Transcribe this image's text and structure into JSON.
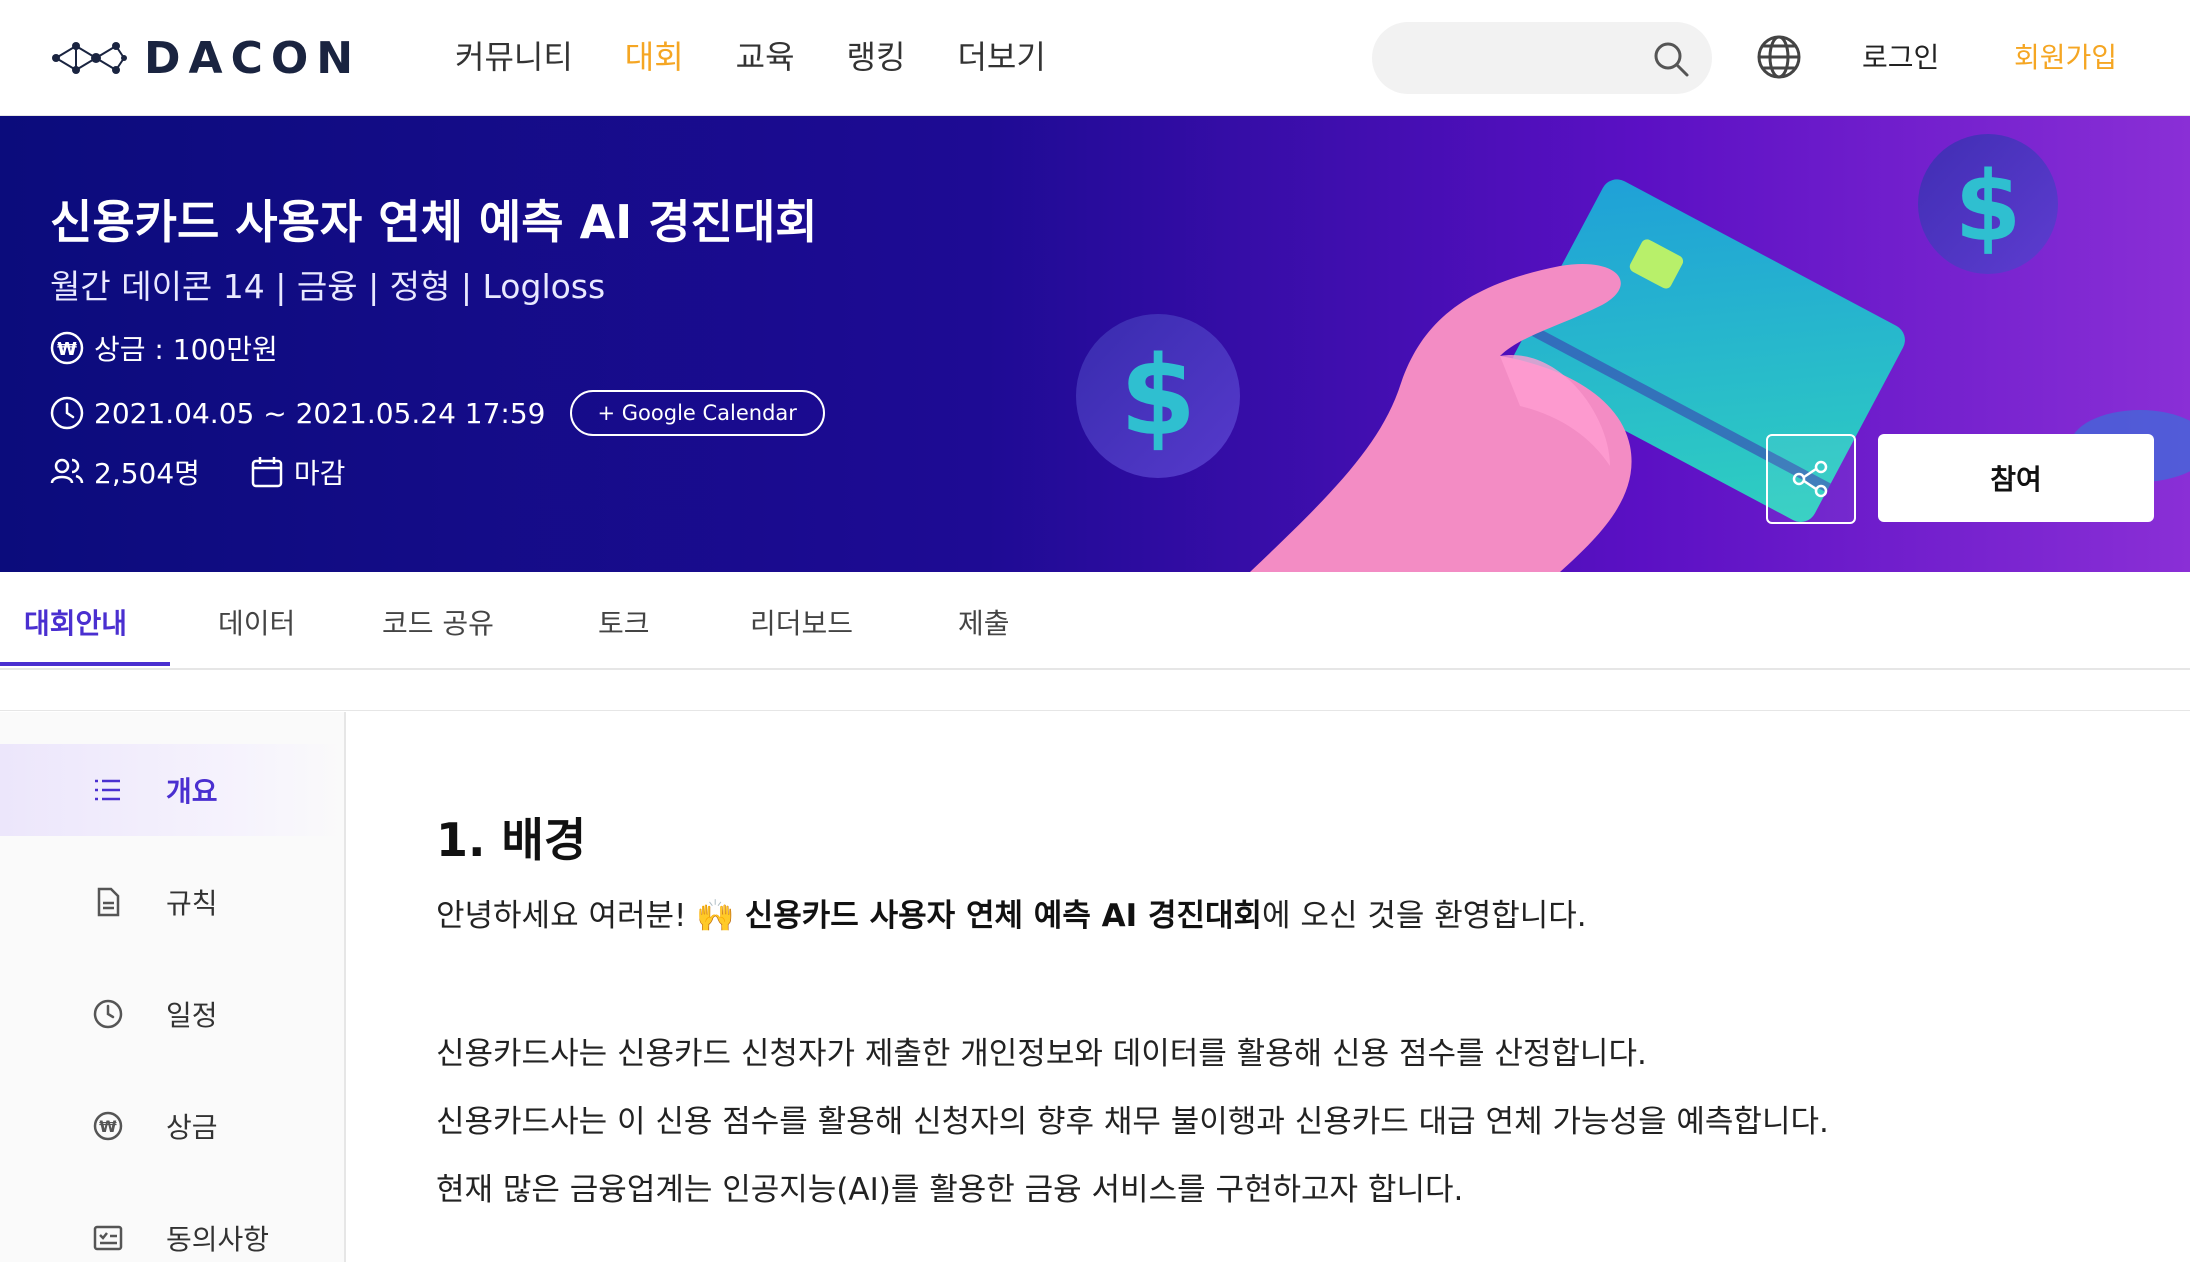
{
  "header": {
    "logo_text": "DACON",
    "nav": [
      "커뮤니티",
      "대회",
      "교육",
      "랭킹",
      "더보기"
    ],
    "active_nav": "대회",
    "search_placeholder": "",
    "login": "로그인",
    "signup": "회원가입"
  },
  "banner": {
    "title": "신용카드 사용자 연체 예측 AI 경진대회",
    "subtitle": "월간 데이콘 14 | 금융 | 정형 | Logloss",
    "prize": "상금 : 100만원",
    "period": "2021.04.05 ~ 2021.05.24 17:59",
    "calendar_button": "+ Google Calendar",
    "participants": "2,504명",
    "status": "마감",
    "join_button": "참여"
  },
  "tabs": [
    "대회안내",
    "데이터",
    "코드 공유",
    "토크",
    "리더보드",
    "제출"
  ],
  "sidebar": {
    "items": [
      {
        "label": "개요",
        "icon": "list-icon"
      },
      {
        "label": "규칙",
        "icon": "document-icon"
      },
      {
        "label": "일정",
        "icon": "clock-icon"
      },
      {
        "label": "상금",
        "icon": "won-icon"
      },
      {
        "label": "동의사항",
        "icon": "checklist-icon"
      }
    ]
  },
  "content": {
    "heading": "1. 배경",
    "greeting_prefix": "안녕하세요 여러분! 🙌 ",
    "greeting_bold": "신용카드 사용자 연체 예측 AI 경진대회",
    "greeting_suffix": "에 오신 것을 환영합니다.",
    "paragraphs": [
      "신용카드사는 신용카드 신청자가 제출한 개인정보와 데이터를 활용해 신용 점수를 산정합니다.",
      "신용카드사는 이 신용 점수를 활용해 신청자의 향후 채무 불이행과 신용카드 대급 연체 가능성을 예측합니다.",
      "현재 많은 금융업계는 인공지능(AI)를 활용한 금융 서비스를 구현하고자 합니다."
    ]
  },
  "colors": {
    "accent_orange": "#f5a623",
    "accent_purple": "#4a2fd0",
    "banner_start": "#0b0c7c",
    "banner_end": "#8a2fd6"
  }
}
